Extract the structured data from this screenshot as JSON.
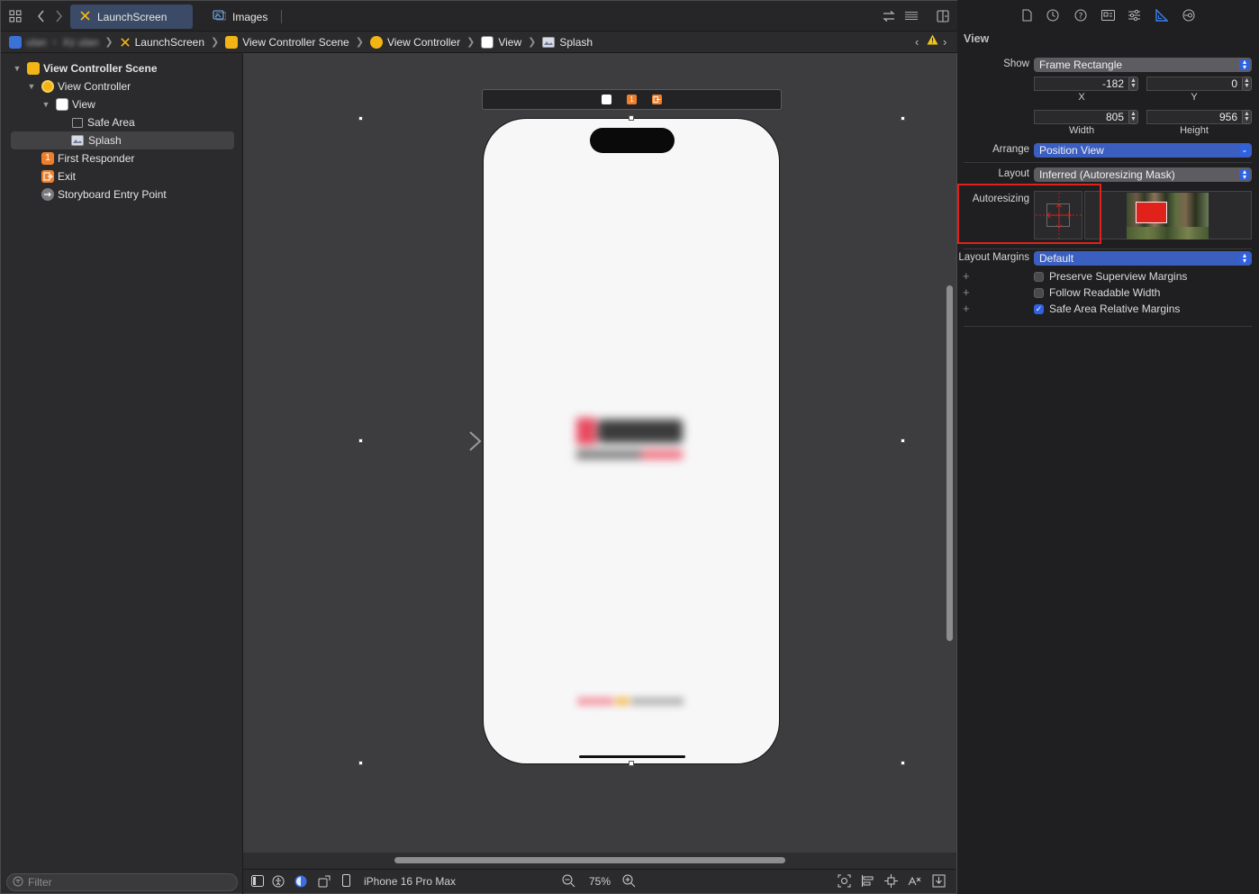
{
  "tabs": [
    {
      "label": "LaunchScreen",
      "active": true
    },
    {
      "label": "Images",
      "active": false
    }
  ],
  "breadcrumb": {
    "redacted": [
      "ulan",
      "Xz ulan"
    ],
    "items": [
      "LaunchScreen",
      "View Controller Scene",
      "View Controller",
      "View",
      "Splash"
    ]
  },
  "outline": {
    "items": [
      {
        "label": "View Controller Scene",
        "bold": true
      },
      {
        "label": "View Controller"
      },
      {
        "label": "View"
      },
      {
        "label": "Safe Area"
      },
      {
        "label": "Splash",
        "selected": true
      },
      {
        "label": "First Responder",
        "badge": "1"
      },
      {
        "label": "Exit"
      },
      {
        "label": "Storyboard Entry Point"
      }
    ]
  },
  "filter": {
    "placeholder": "Filter"
  },
  "bottombar": {
    "device": "iPhone 16 Pro Max",
    "zoom": "75%"
  },
  "inspector": {
    "title": "View",
    "show_label": "Show",
    "show_value": "Frame Rectangle",
    "x": "-182",
    "y": "0",
    "x_label": "X",
    "y_label": "Y",
    "width": "805",
    "height": "956",
    "width_label": "Width",
    "height_label": "Height",
    "arrange_label": "Arrange",
    "arrange_value": "Position View",
    "layout_label": "Layout",
    "layout_value": "Inferred (Autoresizing Mask)",
    "autoresizing_label": "Autoresizing",
    "layout_margins_label": "Layout Margins",
    "layout_margins_value": "Default",
    "checkboxes": [
      {
        "label": "Preserve Superview Margins",
        "checked": false
      },
      {
        "label": "Follow Readable Width",
        "checked": false
      },
      {
        "label": "Safe Area Relative Margins",
        "checked": true
      }
    ]
  },
  "colors": {
    "highlight_box": "#e0221b",
    "accent_blue": "#2f62e2",
    "storyboard_yellow": "#f2b515",
    "responder_orange": "#f07f2c"
  }
}
